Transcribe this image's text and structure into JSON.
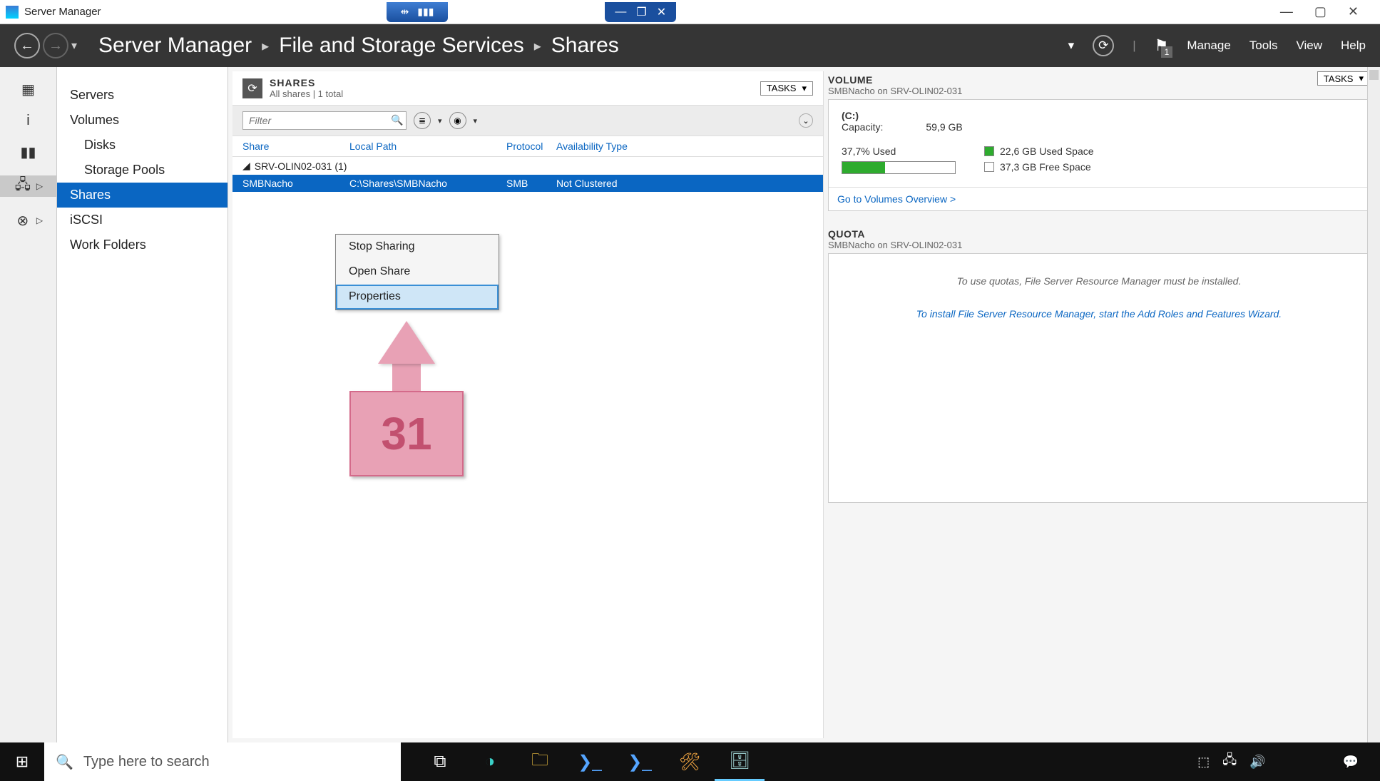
{
  "window": {
    "title": "Server Manager"
  },
  "chrome_accent": {
    "drag_icon": "⇹",
    "signal_icon": "▮▮▮"
  },
  "chrome_win": {
    "min": "—",
    "max": "▢",
    "close": "✕"
  },
  "breadcrumb": {
    "a": "Server Manager",
    "b": "File and Storage Services",
    "c": "Shares"
  },
  "menus": {
    "manage": "Manage",
    "tools": "Tools",
    "view": "View",
    "help": "Help"
  },
  "flag_badge": "1",
  "sidebar": {
    "servers": "Servers",
    "volumes": "Volumes",
    "disks": "Disks",
    "pools": "Storage Pools",
    "shares": "Shares",
    "iscsi": "iSCSI",
    "work": "Work Folders"
  },
  "shares_panel": {
    "title": "SHARES",
    "subtitle": "All shares | 1 total",
    "tasks": "TASKS",
    "filter_placeholder": "Filter",
    "columns": {
      "share": "Share",
      "path": "Local Path",
      "proto": "Protocol",
      "avail": "Availability Type"
    },
    "group": "SRV-OLIN02-031 (1)",
    "row": {
      "share": "SMBNacho",
      "path": "C:\\Shares\\SMBNacho",
      "proto": "SMB",
      "avail": "Not Clustered"
    }
  },
  "context_menu": {
    "stop": "Stop Sharing",
    "open": "Open Share",
    "props": "Properties"
  },
  "volume_panel": {
    "title": "VOLUME",
    "subtitle": "SMBNacho on SRV-OLIN02-031",
    "tasks": "TASKS",
    "drive": "(C:)",
    "cap_label": "Capacity:",
    "cap_value": "59,9 GB",
    "used_pct": "37,7% Used",
    "used_space": "22,6 GB Used Space",
    "free_space": "37,3 GB Free Space",
    "link": "Go to Volumes Overview >"
  },
  "quota_panel": {
    "title": "QUOTA",
    "subtitle": "SMBNacho on SRV-OLIN02-031",
    "line1": "To use quotas, File Server Resource Manager must be installed.",
    "line2": "To install File Server Resource Manager, start the Add Roles and Features Wizard."
  },
  "callout_number": "31",
  "taskbar": {
    "search_placeholder": "Type here to search"
  }
}
